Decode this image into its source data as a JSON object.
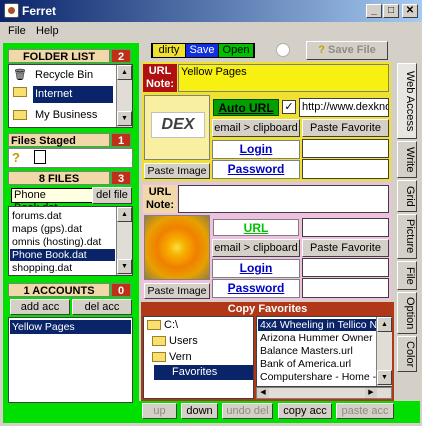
{
  "window": {
    "title": "Ferret"
  },
  "menu": [
    "File",
    "Help"
  ],
  "folder_list": {
    "title": "FOLDER LIST",
    "count": "2",
    "items": [
      "Recycle Bin",
      "Internet",
      "My Business"
    ]
  },
  "files_staged": {
    "title": "Files Staged",
    "count": "1",
    "icons": [
      "question-icon",
      "unknown-file-icon"
    ]
  },
  "files": {
    "title": "8 FILES",
    "count": "3",
    "tooltip": "Phone Book.dat",
    "dl_button": "del file",
    "items": [
      "forums.dat",
      "maps (gps).dat",
      "omnis (hosting).dat",
      "Phone Book.dat",
      "shopping.dat"
    ]
  },
  "accounts": {
    "title": "1 ACCOUNTS",
    "count": "0",
    "add": "add acc",
    "del": "del acc",
    "items": [
      "Yellow Pages"
    ]
  },
  "toolbar": {
    "dirty": "dirty",
    "save": "Save",
    "open": "Open",
    "save_file": "Save File"
  },
  "entry1": {
    "url_label": "URL",
    "note_label": "Note:",
    "name": "Yellow Pages",
    "logo": "DEX",
    "auto_url": "Auto URL",
    "url_value": "http://www.dexknows.",
    "email": "email > clipboard",
    "paste_fav": "Paste Favorite",
    "login": "Login",
    "password": "Password",
    "paste_image": "Paste Image"
  },
  "entry2": {
    "url_label": "URL",
    "note_label": "Note:",
    "name": "",
    "url": "URL",
    "email": "email > clipboard",
    "paste_fav": "Paste Favorite",
    "login": "Login",
    "password": "Password",
    "paste_image": "Paste Image"
  },
  "copy_favorites": {
    "title": "Copy Favorites",
    "folders": [
      "C:\\",
      "Users",
      "Vern",
      "Favorites"
    ],
    "files": [
      "4x4 Wheeling in Tellico N",
      "Arizona Hummer Owner",
      "Balance Masters.url",
      "Bank of America.url",
      "Computershare - Home -"
    ]
  },
  "side_tabs": [
    "Web Access",
    "Write",
    "Grid",
    "Picture",
    "File",
    "Option",
    "Color"
  ],
  "bottom": {
    "up": "up",
    "down": "down",
    "undo": "undo del",
    "copy": "copy acc",
    "paste": "paste acc"
  },
  "colors": {
    "green": "#00e000",
    "red": "#c03018",
    "selection": "#0a246a"
  }
}
